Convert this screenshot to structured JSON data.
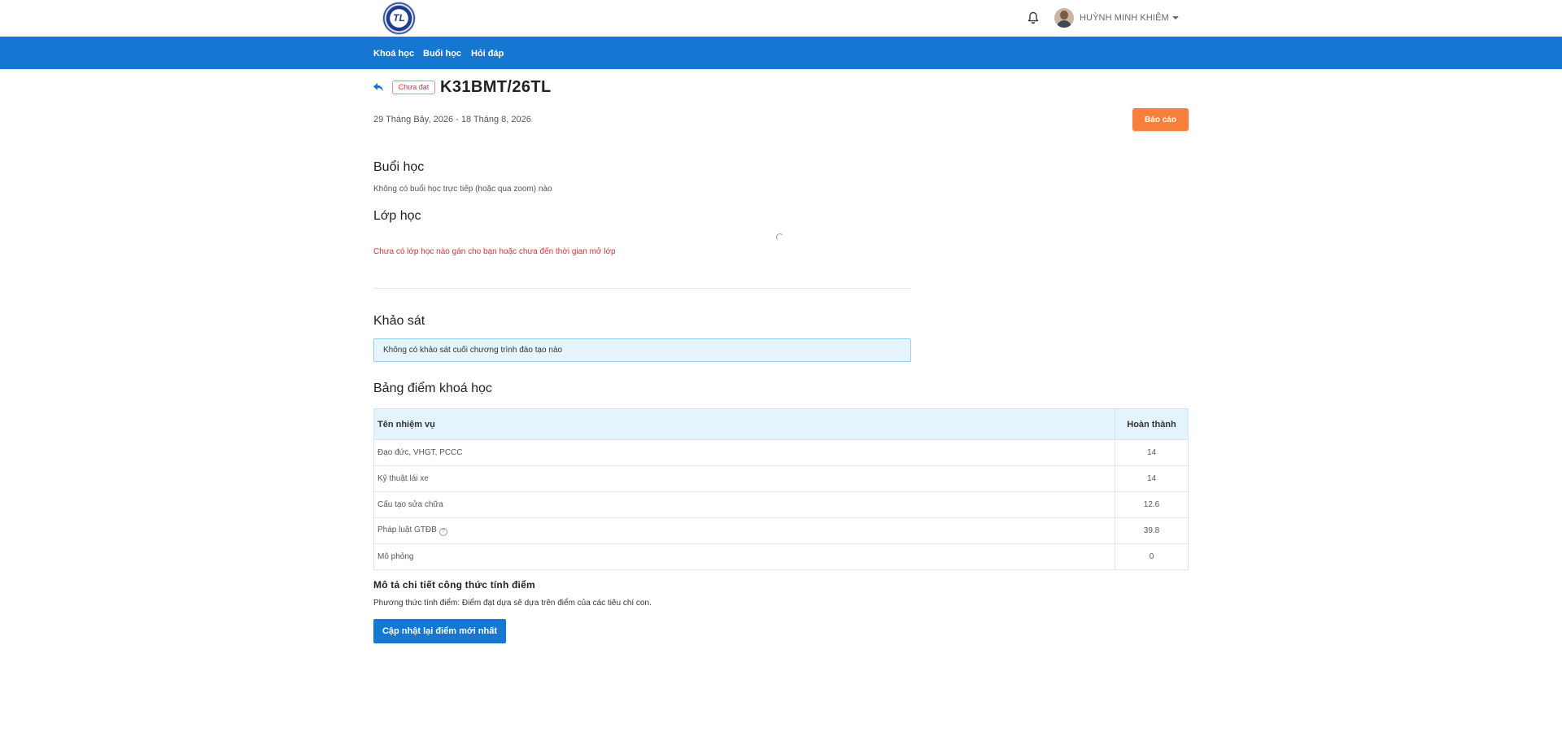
{
  "header": {
    "logo_text": "TL",
    "notification_icon": "bell-icon",
    "user_name": "HUỲNH MINH KHIÊM"
  },
  "nav": {
    "items": [
      {
        "label": "Khoá học"
      },
      {
        "label": "Buổi học"
      },
      {
        "label": "Hỏi đáp"
      }
    ]
  },
  "course": {
    "status": "Chưa đạt",
    "title": "K31BMT/26TL",
    "date_range": "29 Tháng Bảy, 2026 - 18 Tháng 8, 2026",
    "report_label": "Báo cáo"
  },
  "sessions": {
    "heading": "Buổi học",
    "empty_text": "Không có buổi học trực tiếp (hoặc qua zoom) nào"
  },
  "classes": {
    "heading": "Lớp học",
    "warning_text": "Chưa có lớp học nào gán cho bạn hoặc chưa đến thời gian mở lớp"
  },
  "survey": {
    "heading": "Khảo sát",
    "info_text": "Không có khảo sát cuối chương trình đào tạo nào"
  },
  "scoreboard": {
    "heading": "Bảng điểm khoá học",
    "columns": [
      "Tên nhiệm vụ",
      "Hoàn thành"
    ],
    "rows": [
      {
        "name": "Đạo đức, VHGT, PCCC",
        "score": "14"
      },
      {
        "name": "Kỹ thuật lái xe",
        "score": "14"
      },
      {
        "name": "Cấu tạo sửa chữa",
        "score": "12.6"
      },
      {
        "name": "Pháp luật GTĐB",
        "score": "39.8"
      },
      {
        "name": "Mô phỏng",
        "score": "0"
      }
    ],
    "formula_heading": "Mô tả chi tiết công thức tính điểm",
    "formula_text": "Phương thức tính điểm: Điểm đạt dựa sẽ dựa trên điểm của các tiêu chí con.",
    "update_label": "Cập nhật lại điểm mới nhất"
  },
  "colors": {
    "primary": "#1677d3",
    "accent": "#f6803b",
    "danger": "#e03131"
  }
}
